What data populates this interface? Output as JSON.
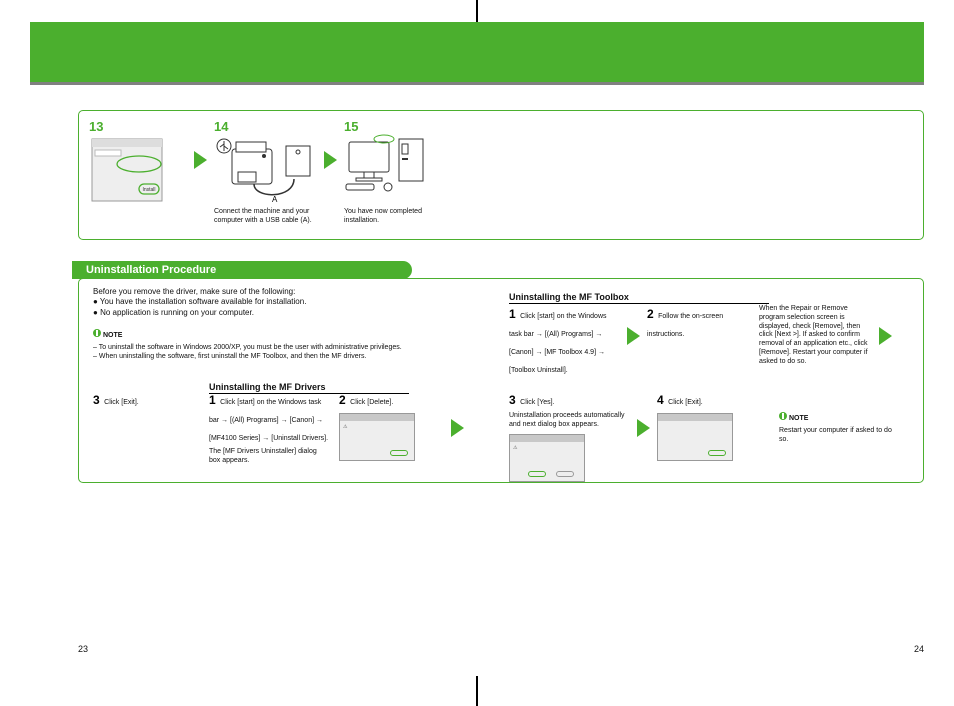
{
  "top": {
    "steps": {
      "s13": "13",
      "s14": "14",
      "s15": "15",
      "label14": "A",
      "cap14": "Connect the machine and your computer with a USB cable (A).",
      "cap15": "You have now completed installation."
    }
  },
  "header": "Uninstallation Procedure",
  "pre": {
    "intro": "Before you remove the driver, make sure of the following:",
    "b1": "You have the installation software available for installation.",
    "b2": "No application is running on your computer.",
    "noteLabel": "NOTE",
    "n1": "– To uninstall the software in Windows 2000/XP, you must be the user with administrative privileges.",
    "n2": "– When uninstalling the software, first uninstall the MF Toolbox, and then the MF drivers."
  },
  "toolbox": {
    "title": "Uninstalling the MF Toolbox",
    "s1n": "1",
    "s1": "Click [start] on the Windows task bar → [(All) Programs] → [Canon] → [MF Toolbox 4.9] → [Toolbox Uninstall].",
    "s2n": "2",
    "s2": "Follow the on-screen instructions.",
    "note": "When the Repair or Remove program selection screen is displayed, check [Remove], then click [Next >]. If asked to confirm removal of an application etc., click [Remove]. Restart your computer if asked to do so.",
    "s3n": "3",
    "s3": "Click [Exit]."
  },
  "drivers": {
    "title": "Uninstalling the MF Drivers",
    "s1n": "1",
    "s1": "Click [start] on the Windows task bar → [(All) Programs] → [Canon] → [MF4100 Series] → [Uninstall Drivers].",
    "s1b": "The [MF Drivers Uninstaller] dialog box appears.",
    "s2n": "2",
    "s2": "Click [Delete].",
    "s3n": "3",
    "s3": "Click [Yes].",
    "s3b": "Uninstallation proceeds automatically and next dialog box appears.",
    "s4n": "4",
    "s4": "Click [Exit].",
    "noteLabel": "NOTE",
    "note": "Restart your computer if asked to do so."
  },
  "pg": {
    "l": "23",
    "r": "24"
  }
}
